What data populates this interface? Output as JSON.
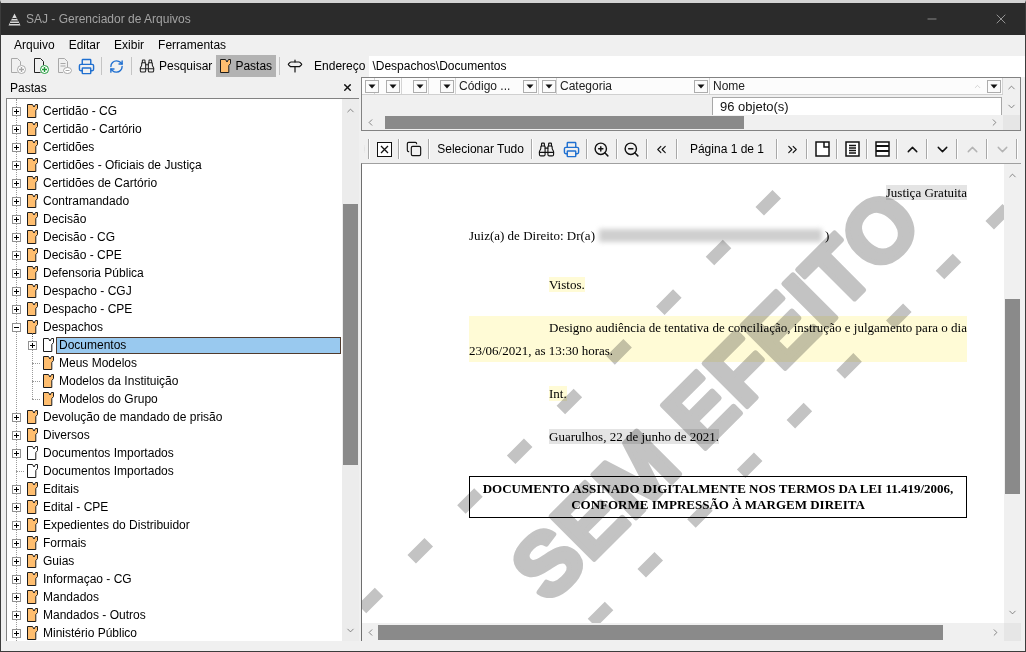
{
  "window": {
    "title": "SAJ - Gerenciador de Arquivos"
  },
  "menu": [
    {
      "label": "Arquivo"
    },
    {
      "label": "Editar"
    },
    {
      "label": "Exibir"
    },
    {
      "label": "Ferramentas"
    }
  ],
  "toolbar": {
    "items": [
      {
        "kind": "new-document",
        "disabled": true
      },
      {
        "kind": "new-document",
        "disabled": false
      },
      {
        "kind": "properties",
        "disabled": true
      },
      {
        "kind": "print",
        "disabled": false
      },
      {
        "kind": "separator"
      },
      {
        "kind": "refresh",
        "disabled": false
      },
      {
        "kind": "separator"
      },
      {
        "kind": "search",
        "label": "Pesquisar",
        "disabled": false,
        "pressed": false
      },
      {
        "kind": "folders",
        "label": "Pastas",
        "disabled": false,
        "pressed": true
      },
      {
        "kind": "separator"
      }
    ],
    "address": {
      "label": "Endereço",
      "value": "\\Despachos\\Documentos"
    }
  },
  "folders_panel": {
    "title": "Pastas",
    "tree": [
      {
        "label": "Certidão - CG",
        "kind": "folder",
        "expandable": true,
        "expanded": false,
        "selected": false
      },
      {
        "label": "Certidão - Cartório",
        "kind": "folder",
        "expandable": true,
        "expanded": false,
        "selected": false
      },
      {
        "label": "Certidões",
        "kind": "folder",
        "expandable": true,
        "expanded": false,
        "selected": false
      },
      {
        "label": "Certidões - Oficiais de Justiça",
        "kind": "folder",
        "expandable": true,
        "expanded": false,
        "selected": false
      },
      {
        "label": "Certidões de Cartório",
        "kind": "folder",
        "expandable": true,
        "expanded": false,
        "selected": false
      },
      {
        "label": "Contramandado",
        "kind": "folder",
        "expandable": true,
        "expanded": false,
        "selected": false
      },
      {
        "label": "Decisão",
        "kind": "folder",
        "expandable": true,
        "expanded": false,
        "selected": false
      },
      {
        "label": "Decisão - CG",
        "kind": "folder",
        "expandable": true,
        "expanded": false,
        "selected": false
      },
      {
        "label": "Decisão - CPE",
        "kind": "folder",
        "expandable": true,
        "expanded": false,
        "selected": false
      },
      {
        "label": "Defensoria Pública",
        "kind": "folder",
        "expandable": true,
        "expanded": false,
        "selected": false
      },
      {
        "label": "Despacho - CGJ",
        "kind": "folder",
        "expandable": true,
        "expanded": false,
        "selected": false
      },
      {
        "label": "Despacho - CPE",
        "kind": "folder",
        "expandable": true,
        "expanded": false,
        "selected": false
      },
      {
        "label": "Despachos",
        "kind": "folder",
        "expandable": true,
        "expanded": true,
        "selected": false,
        "children": [
          {
            "label": "Documentos",
            "kind": "document-folder",
            "expandable": true,
            "expanded": false,
            "selected": true
          },
          {
            "label": "Meus Modelos",
            "kind": "folder",
            "expandable": false,
            "expanded": false,
            "selected": false
          },
          {
            "label": "Modelos da Instituição",
            "kind": "folder",
            "expandable": false,
            "expanded": false,
            "selected": false
          },
          {
            "label": "Modelos do Grupo",
            "kind": "folder",
            "expandable": false,
            "expanded": false,
            "selected": false
          }
        ]
      },
      {
        "label": "Devolução de mandado de prisão",
        "kind": "folder",
        "expandable": true,
        "expanded": false,
        "selected": false
      },
      {
        "label": "Diversos",
        "kind": "folder",
        "expandable": true,
        "expanded": false,
        "selected": false
      },
      {
        "label": "Documentos Importados",
        "kind": "document-folder",
        "expandable": true,
        "expanded": false,
        "selected": false
      },
      {
        "label": "Documentos Importados",
        "kind": "document-folder",
        "expandable": false,
        "expanded": false,
        "selected": false
      },
      {
        "label": "Editais",
        "kind": "folder",
        "expandable": true,
        "expanded": false,
        "selected": false
      },
      {
        "label": "Edital - CPE",
        "kind": "folder",
        "expandable": true,
        "expanded": false,
        "selected": false
      },
      {
        "label": "Expedientes do Distribuidor",
        "kind": "folder",
        "expandable": true,
        "expanded": false,
        "selected": false
      },
      {
        "label": "Formais",
        "kind": "folder",
        "expandable": true,
        "expanded": false,
        "selected": false
      },
      {
        "label": "Guias",
        "kind": "folder",
        "expandable": true,
        "expanded": false,
        "selected": false
      },
      {
        "label": "Informaçao - CG",
        "kind": "folder",
        "expandable": true,
        "expanded": false,
        "selected": false
      },
      {
        "label": "Mandados",
        "kind": "folder",
        "expandable": true,
        "expanded": false,
        "selected": false
      },
      {
        "label": "Mandados - Outros",
        "kind": "folder",
        "expandable": true,
        "expanded": false,
        "selected": false
      },
      {
        "label": "Ministério Público",
        "kind": "folder",
        "expandable": true,
        "expanded": false,
        "selected": false
      }
    ]
  },
  "list": {
    "columns": [
      {
        "sorted": false
      },
      {
        "sorted": false
      },
      {
        "sorted": false
      },
      {
        "sorted": false
      },
      {
        "label": "Código ...",
        "sorted": false
      },
      {
        "sorted": false
      },
      {
        "label": "Categoria",
        "sorted": false
      },
      {
        "label": "Nome",
        "sorted": true
      }
    ],
    "count": "96 objeto(s)"
  },
  "document_toolbar": {
    "groups": [
      [
        {
          "kind": "close",
          "disabled": false
        }
      ],
      [
        {
          "kind": "copy",
          "disabled": false
        }
      ],
      [
        {
          "kind": "text",
          "label": "Selecionar Tudo",
          "disabled": false
        }
      ],
      [
        {
          "kind": "search",
          "disabled": false
        },
        {
          "kind": "print",
          "disabled": false
        }
      ],
      [
        {
          "kind": "zoom-in",
          "disabled": false
        }
      ],
      [
        {
          "kind": "zoom-out",
          "disabled": false
        }
      ],
      [
        {
          "kind": "previous",
          "disabled": false
        }
      ],
      [
        {
          "kind": "status",
          "label": "Página 1 de 1"
        }
      ],
      [
        {
          "kind": "next",
          "disabled": false
        }
      ],
      [
        {
          "kind": "single-page",
          "disabled": false
        }
      ],
      [
        {
          "kind": "text-page",
          "disabled": false
        }
      ],
      [
        {
          "kind": "band-page",
          "disabled": false
        }
      ],
      [
        {
          "kind": "up",
          "disabled": false
        }
      ],
      [
        {
          "kind": "down",
          "disabled": false
        }
      ],
      [
        {
          "kind": "up",
          "disabled": true
        }
      ],
      [
        {
          "kind": "down",
          "disabled": true
        }
      ]
    ]
  },
  "document": {
    "watermark": "SEM EFEITO",
    "paragraphs": [
      {
        "kind": "right",
        "text": "Justiça Gratuita",
        "color": "#e4e4e4"
      },
      {
        "kind": "redacted",
        "text": "Juiz(a) de Direito: Dr(a)",
        "suffix": ")"
      },
      {
        "kind": "indented",
        "text": "Vistos.",
        "color": "#fffbd6"
      },
      {
        "kind": "justified",
        "text": "Designo audiência de tentativa de conciliação, instrução e julgamento para o dia 23/06/2021, as 13:30 horas.",
        "color": "#fffbd6"
      },
      {
        "kind": "indented",
        "text": "Int.",
        "color": "#fffbd6"
      },
      {
        "kind": "indented",
        "text": "Guarulhos, 22 de junho de 2021.",
        "color": "#e4e4e4"
      },
      {
        "kind": "boxed",
        "text": "DOCUMENTO ASSINADO DIGITALMENTE NOS TERMOS DA LEI 11.419/2006, CONFORME IMPRESSÃO À MARGEM DIREITA"
      }
    ]
  }
}
